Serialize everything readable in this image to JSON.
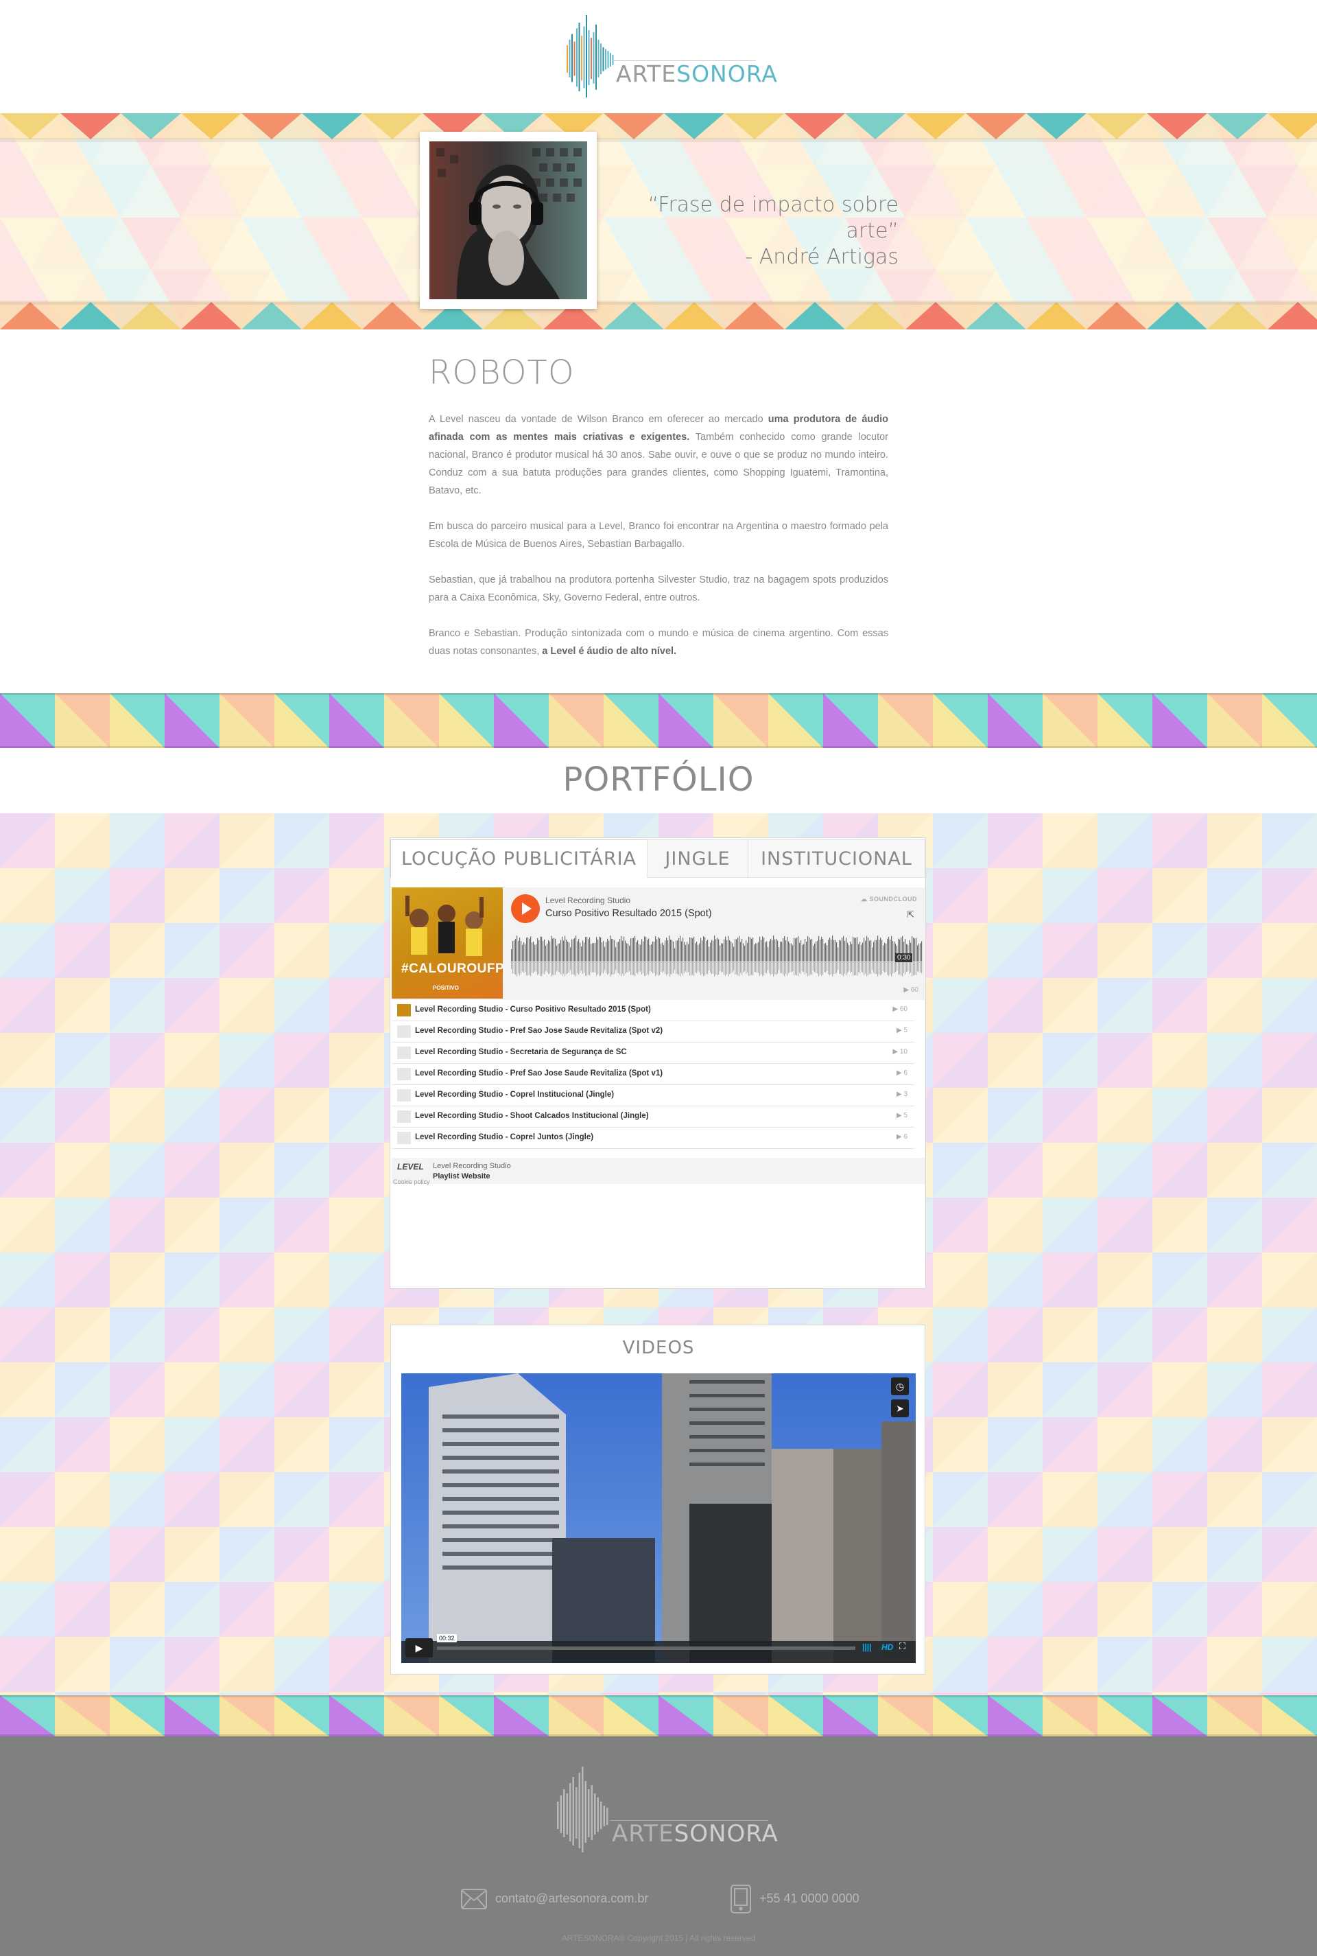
{
  "brand": {
    "name_part1": "ARTE",
    "name_part2": "SONORA"
  },
  "hero": {
    "quote_line1": "“Frase de impacto sobre arte”",
    "quote_line2": "- André Artigas"
  },
  "about": {
    "title": "ROBOTO",
    "p1_a": "A Level nasceu da vontade de Wilson Branco em oferecer ao mercado ",
    "p1_b": "uma produtora de áudio afinada com as mentes mais criativas e exigentes.",
    "p1_c": " Também conhecido como grande locutor nacional, Branco é produtor musical há 30 anos. Sabe ouvir, e ouve o que se produz no mundo inteiro. Conduz com a sua batuta produções para grandes clientes, como Shopping Iguatemi, Tramontina, Batavo, etc.",
    "p2": "Em busca do parceiro musical para a Level, Branco foi encontrar na Argentina o maestro formado pela Escola de Música de Buenos Aires, Sebastian Barbagallo.",
    "p3": "Sebastian, que já trabalhou na produtora portenha Silvester Studio, traz na bagagem spots produzidos para a Caixa Econômica, Sky, Governo Federal, entre outros.",
    "p4_a": "Branco e Sebastian. Produção sintonizada com o mundo e música de cinema argentino. Com essas duas notas consonantes, ",
    "p4_b": "a Level é áudio de alto nível."
  },
  "portfolio": {
    "title": "PORTFÓLIO",
    "tabs": [
      "LOCUÇÃO PUBLICITÁRIA",
      "JINGLE",
      "INSTITUCIONAL"
    ],
    "player": {
      "artist": "Level Recording Studio",
      "track": "Curso Positivo Resultado 2015 (Spot)",
      "brand": "SOUNDCLOUD",
      "duration": "0:30",
      "plays": "▶ 60",
      "art_text": "#CALOUROUFPR",
      "art_badge": "POSITIVO",
      "tracks": [
        {
          "title": "Level Recording Studio - Curso Positivo Resultado 2015 (Spot)",
          "count": "▶ 60"
        },
        {
          "title": "Level Recording Studio - Pref Sao Jose Saude Revitaliza (Spot v2)",
          "count": "▶ 5"
        },
        {
          "title": "Level Recording Studio - Secretaria de Segurança de SC",
          "count": "▶ 10"
        },
        {
          "title": "Level Recording Studio - Pref Sao Jose Saude Revitaliza (Spot v1)",
          "count": "▶ 6"
        },
        {
          "title": "Level Recording Studio - Coprel Institucional (Jingle)",
          "count": "▶ 3"
        },
        {
          "title": "Level Recording Studio - Shoot Calcados Institucional (Jingle)",
          "count": "▶ 5"
        },
        {
          "title": "Level Recording Studio - Coprel Juntos (Jingle)",
          "count": "▶ 6"
        }
      ],
      "footer_artist": "Level Recording Studio",
      "footer_playlist": "Playlist Website",
      "cookie": "Cookie policy"
    }
  },
  "videos": {
    "title": "VIDEOS",
    "time": "00:32",
    "hd": "HD"
  },
  "footer": {
    "email": "contato@artesonora.com.br",
    "phone": "+55 41 0000 0000",
    "copyright": "ARTESONORA® Copyright 2015 | All rights reserved"
  },
  "colors": {
    "teal": "#5cb8c6",
    "orange": "#f25c22",
    "footer_bg": "#808080"
  }
}
